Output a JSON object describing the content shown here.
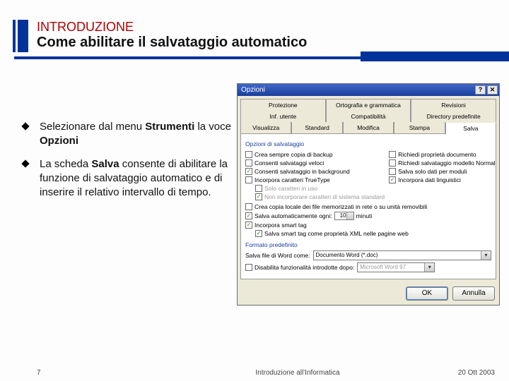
{
  "header": {
    "intro": "INTRODUZIONE",
    "title": "Come abilitare il salvataggio automatico"
  },
  "bullets": [
    {
      "pre": "Selezionare dal menu ",
      "bold1": "Strumenti",
      "mid": " la voce ",
      "bold2": "Opzioni"
    },
    {
      "pre": "La scheda ",
      "bold1": "Salva",
      "mid": " consente di abilitare la funzione di salvataggio automatico e di inserire il relativo intervallo di tempo.",
      "bold2": ""
    }
  ],
  "dialog": {
    "title": "Opzioni",
    "help_btn": "?",
    "close_btn": "✕",
    "tabs_row1": [
      "Protezione",
      "Ortografia e grammatica",
      "Revisioni"
    ],
    "tabs_row2": [
      "Inf. utente",
      "Compatibilità",
      "Directory predefinite"
    ],
    "tabs_row3": [
      "Visualizza",
      "Standard",
      "Modifica",
      "Stampa",
      "Salva"
    ],
    "group1": "Opzioni di salvataggio",
    "left_checks": [
      "Crea sempre copia di backup",
      "Consenti salvataggi veloci",
      "Consenti salvataggio in background",
      "Incorpora caratteri TrueType"
    ],
    "left_subs": [
      "Solo caratteri in uso",
      "Non incorporare caratteri di sistema standard"
    ],
    "right_checks": [
      "Richiedi proprietà documento",
      "Richiedi salvataggio modello Normal",
      "Salva solo dati per moduli",
      "Incorpora dati linguistici"
    ],
    "data_copy": "Crea copia locale dei file memorizzati in rete o su unità removibili",
    "autosave_label": "Salva automaticamente ogni:",
    "autosave_value": "10",
    "autosave_unit": "minuti",
    "smarttag_label": "Incorpora smart tag",
    "smarttag_xml": "Salva smart tag come proprietà XML nelle pagine web",
    "group2": "Formato predefinito",
    "saveas_label": "Salva file di Word come:",
    "saveas_value": "Documento Word (*.doc)",
    "disable_label": "Disabilita funzionalità introdotte dopo:",
    "disable_value": "Microsoft Word 97",
    "ok": "OK",
    "cancel": "Annulla"
  },
  "footer": {
    "page": "7",
    "center": "Introduzione all'Informatica",
    "date": "20 Ott 2003"
  }
}
